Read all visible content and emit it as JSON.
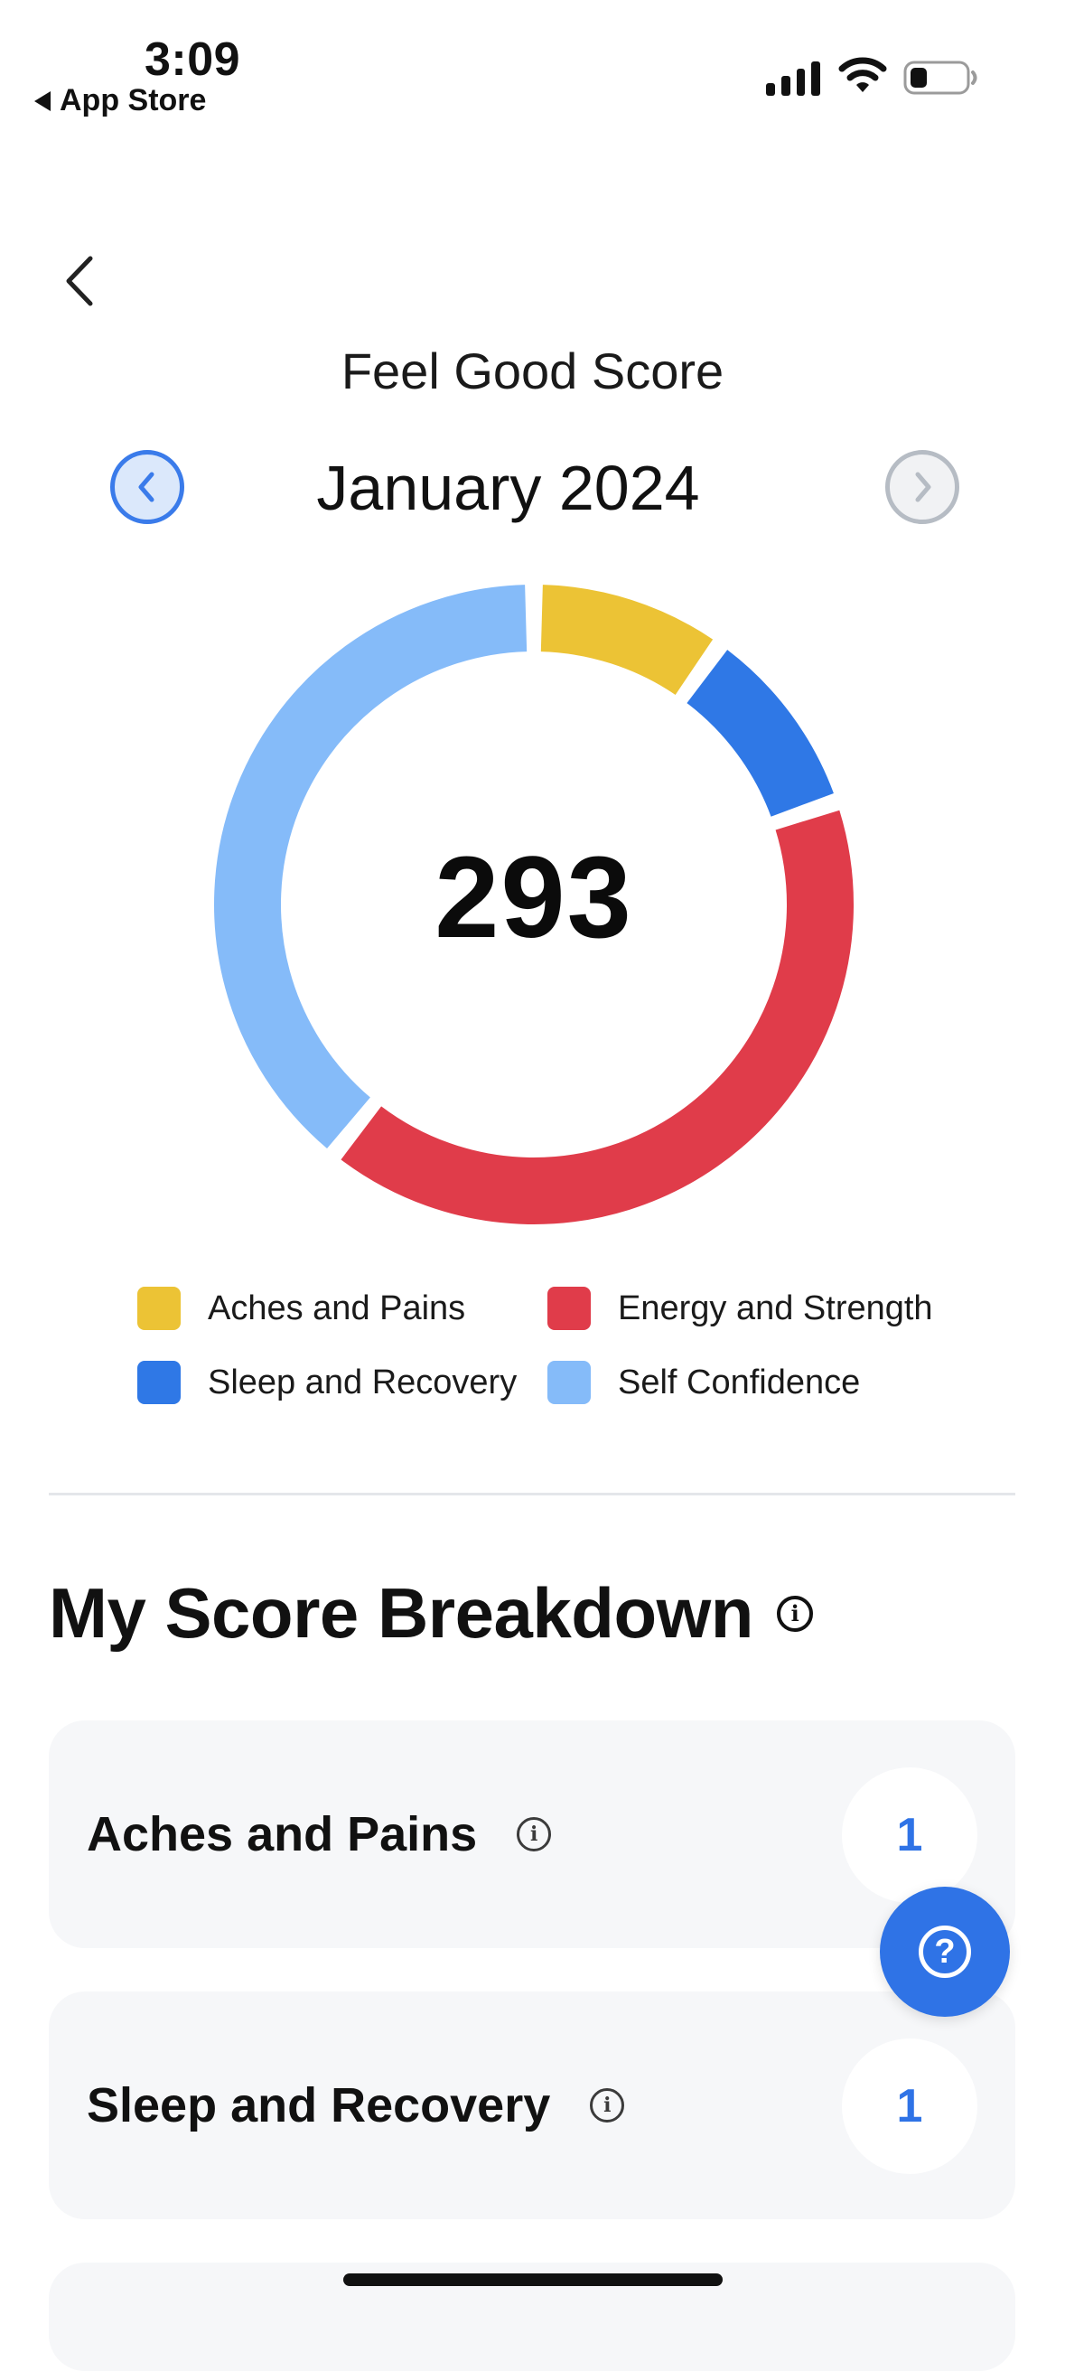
{
  "status_bar": {
    "time": "3:09",
    "back_app_label": "App Store"
  },
  "header": {
    "title": "Feel Good Score",
    "month": "January 2024",
    "icons": {
      "back": "chevron-left-icon",
      "prev": "chevron-left-circle-icon",
      "next": "chevron-right-circle-icon"
    }
  },
  "chart_data": {
    "type": "pie",
    "total_label": "293",
    "categories": [
      "Aches and Pains",
      "Sleep and Recovery",
      "Energy and Strength",
      "Self Confidence"
    ],
    "values": [
      29,
      29,
      120,
      115
    ],
    "colors": [
      "#ecc335",
      "#2f78e6",
      "#e03c4a",
      "#85bbf9"
    ]
  },
  "legend": {
    "items": [
      {
        "label": "Aches and Pains",
        "color": "#ecc335"
      },
      {
        "label": "Energy and Strength",
        "color": "#e03c4a"
      },
      {
        "label": "Sleep and Recovery",
        "color": "#2f78e6"
      },
      {
        "label": "Self Confidence",
        "color": "#85bbf9"
      }
    ]
  },
  "breakdown": {
    "title": "My Score Breakdown",
    "cards": [
      {
        "label": "Aches and Pains",
        "score": "1"
      },
      {
        "label": "Sleep and Recovery",
        "score": "1"
      }
    ]
  },
  "help_button_icon": "question-circle-icon",
  "colors": {
    "accent": "#2f73e6",
    "card_bg": "#f6f7f9"
  }
}
